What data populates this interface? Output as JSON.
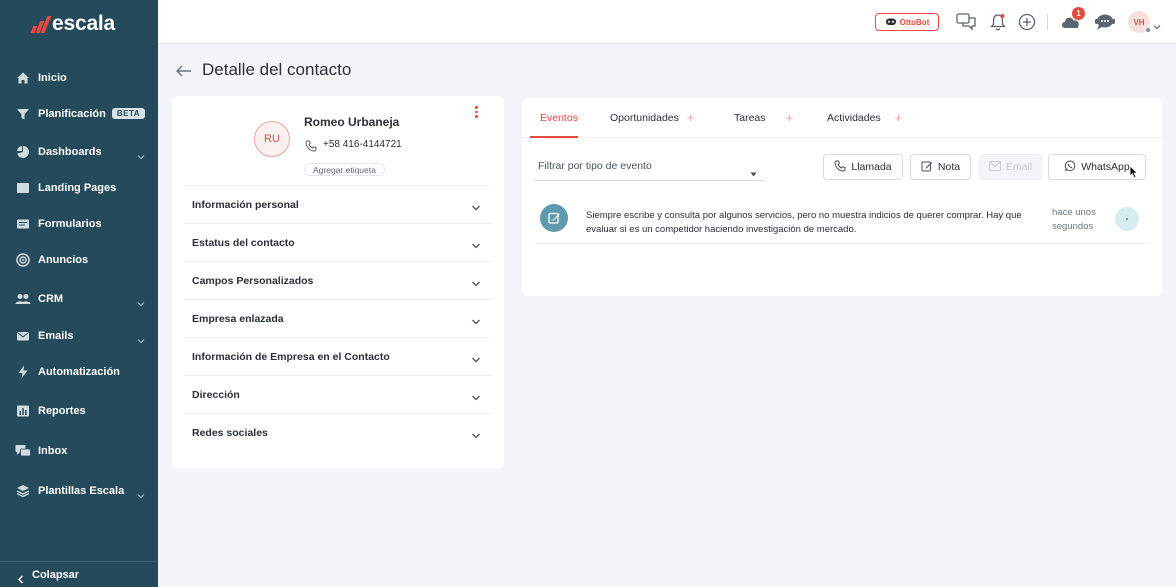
{
  "brand": {
    "name": "escala",
    "logo_color": "#e8483f",
    "sidebar_bg": "#244a5b",
    "accent": "#e8483f"
  },
  "sidebar": {
    "items": [
      {
        "label": "Inicio",
        "icon": "home-icon"
      },
      {
        "label": "Planificación",
        "icon": "filter-funnel-icon",
        "badge": "BETA"
      },
      {
        "label": "Dashboards",
        "icon": "pie-chart-icon",
        "has_submenu": true
      },
      {
        "label": "Landing Pages",
        "icon": "landing-page-icon"
      },
      {
        "label": "Formularios",
        "icon": "form-icon"
      },
      {
        "label": "Anuncios",
        "icon": "target-icon"
      },
      {
        "label": "CRM",
        "icon": "people-icon",
        "has_submenu": true
      },
      {
        "label": "Emails",
        "icon": "mail-icon",
        "has_submenu": true
      },
      {
        "label": "Automatización",
        "icon": "bolt-icon"
      },
      {
        "label": "Reportes",
        "icon": "bar-chart-icon"
      },
      {
        "label": "Inbox",
        "icon": "chat-icon"
      },
      {
        "label": "Plantillas Escala",
        "icon": "layers-icon",
        "has_submenu": true
      }
    ],
    "collapse_label": "Colapsar"
  },
  "topbar": {
    "ottobot_label": "OttoBot",
    "notification_count": "1",
    "avatar_initials": "VH",
    "icons": [
      "chat-bubbles-icon",
      "bell-icon",
      "add-circle-icon",
      "cloud-icon",
      "support-chat-icon"
    ]
  },
  "page": {
    "title": "Detalle del contacto"
  },
  "contact": {
    "initials": "RU",
    "name": "Romeo Urbaneja",
    "phone": "+58 416-4144721",
    "tag_button": "Agregar etiqueta",
    "sections": [
      "Información personal",
      "Estatus del contacto",
      "Campos Personalizados",
      "Empresa enlazada",
      "Información de Empresa en el Contacto",
      "Dirección",
      "Redes sociales"
    ]
  },
  "activity": {
    "tabs": [
      {
        "label": "Eventos",
        "active": true,
        "has_add": false
      },
      {
        "label": "Oportunidades",
        "active": false,
        "has_add": true
      },
      {
        "label": "Tareas",
        "active": false,
        "has_add": true
      },
      {
        "label": "Actividades",
        "active": false,
        "has_add": true
      }
    ],
    "filter_placeholder": "Filtrar por tipo de evento",
    "buttons": {
      "call": "Llamada",
      "note": "Nota",
      "email": "Email",
      "whatsapp": "WhatsApp"
    },
    "events": [
      {
        "text": "Siempre escribe y consulta por algunos servicios, pero no muestra indicios de querer comprar. Hay que evaluar si es un competidor haciendo investigación de mercado.",
        "time": "hace unos segundos",
        "icon": "note-edit-icon"
      }
    ]
  }
}
